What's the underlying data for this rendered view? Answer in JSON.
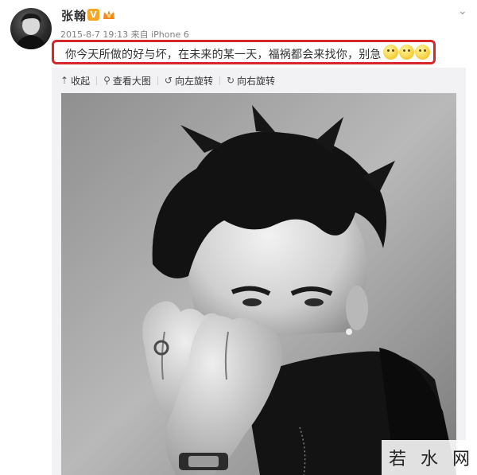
{
  "post": {
    "author": {
      "name": "张翰",
      "verified_mark": "V",
      "avatar_icon": "avatar-portrait-icon",
      "badge_icon": "vip-crown-icon"
    },
    "meta": "2015-8-7 19:13 来自 iPhone 6",
    "menu_icon": "chevron-down-icon",
    "text": "你今天所做的好与坏，在未来的某一天，福祸都会来找你，别急",
    "emojis": [
      "smile-emoji-icon",
      "smile-emoji-icon",
      "smile-emoji-icon"
    ],
    "highlight_color": "#d8272b"
  },
  "toolbar": {
    "collapse": {
      "icon": "⇡",
      "label": "收起"
    },
    "view_large": {
      "icon": "⚲",
      "label": "查看大图"
    },
    "rotate_left": {
      "icon": "↺",
      "label": "向左旋转"
    },
    "rotate_right": {
      "icon": "↻",
      "label": "向右旋转"
    }
  },
  "photo": {
    "subject": "black-and-white portrait photo"
  },
  "watermark": {
    "chars": [
      "若",
      "水",
      "网"
    ]
  }
}
